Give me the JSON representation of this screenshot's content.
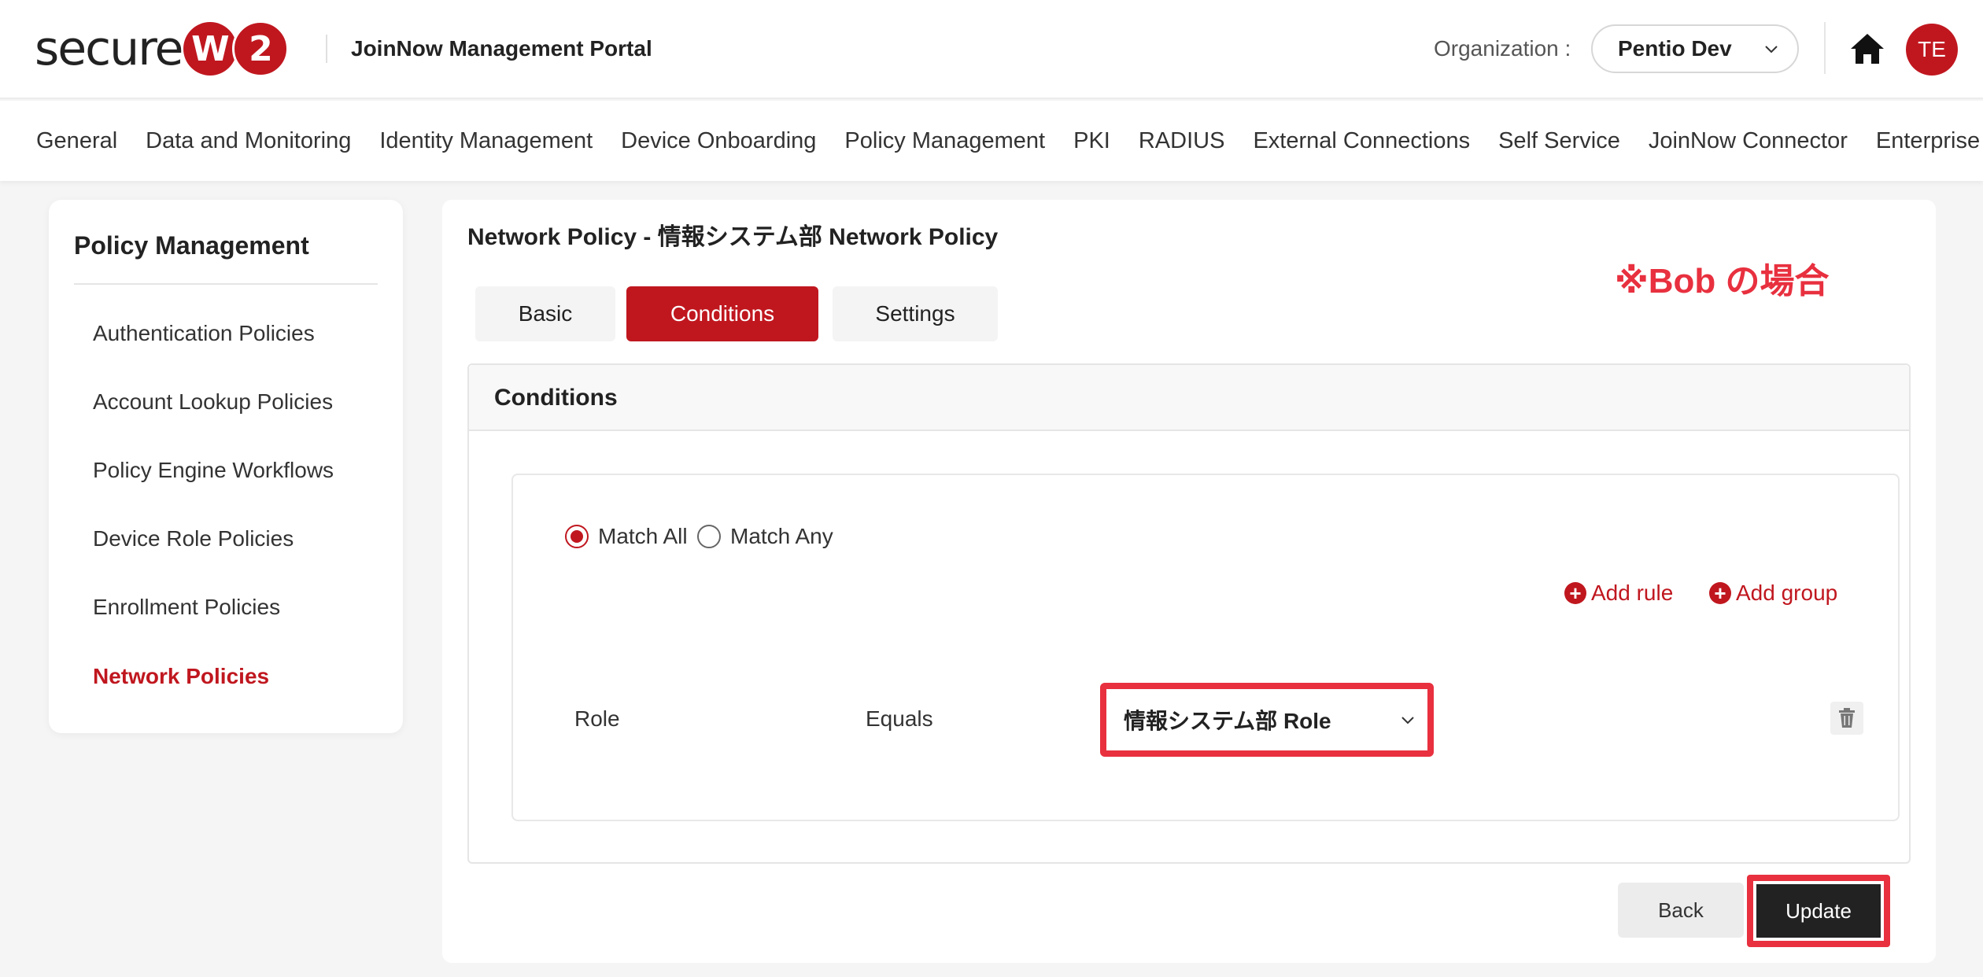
{
  "brand": {
    "logo_text": "secure",
    "logo_w": "W",
    "logo_two": "2",
    "portal_title": "JoinNow Management Portal"
  },
  "header": {
    "org_label": "Organization :",
    "org_value": "Pentio Dev",
    "user_initials": "TE",
    "home_icon": "home-icon",
    "accent_color": "#c0171f"
  },
  "topnav": {
    "items": [
      "General",
      "Data and Monitoring",
      "Identity Management",
      "Device Onboarding",
      "Policy Management",
      "PKI",
      "RADIUS",
      "External Connections",
      "Self Service",
      "JoinNow Connector",
      "Enterprise Client"
    ]
  },
  "sidebar": {
    "title": "Policy Management",
    "items": [
      "Authentication Policies",
      "Account Lookup Policies",
      "Policy Engine Workflows",
      "Device Role Policies",
      "Enrollment Policies",
      "Network Policies"
    ],
    "active_index": 5
  },
  "main": {
    "page_title": "Network Policy - 情報システム部 Network Policy",
    "annotation": "※Bob の場合",
    "tabs": [
      "Basic",
      "Conditions",
      "Settings"
    ],
    "active_tab": "Conditions",
    "panel_title": "Conditions",
    "match_all": "Match All",
    "match_any": "Match Any",
    "match_selected": "Match All",
    "add_rule": "Add rule",
    "add_group": "Add group",
    "rule": {
      "field": "Role",
      "operator": "Equals",
      "value": "情報システム部 Role"
    },
    "back_label": "Back",
    "update_label": "Update",
    "highlight_color": "#e8303f"
  }
}
